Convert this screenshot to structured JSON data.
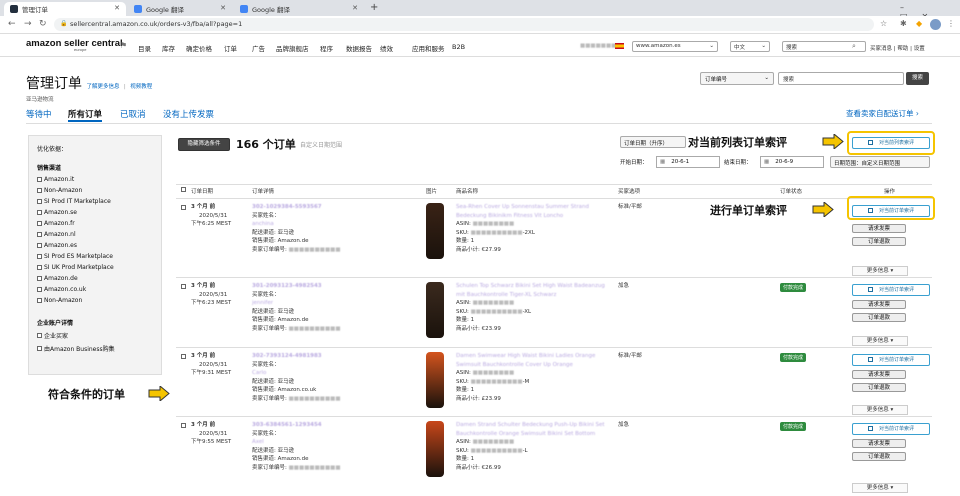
{
  "browser": {
    "tabs": [
      {
        "label": "管理订单",
        "favicon_color": "#232f3e"
      },
      {
        "label": "Google 翻译",
        "favicon_color": "#4285f4"
      },
      {
        "label": "Google 翻译",
        "favicon_color": "#4285f4"
      }
    ],
    "new_tab": "+",
    "url": "sellercentral.amazon.co.uk/orders-v3/fba/all?page=1"
  },
  "header": {
    "logo": "amazon seller central",
    "logo_sub": "europe",
    "nav": [
      "目录",
      "库存",
      "确定价格",
      "订单",
      "广告",
      "品牌旗舰店",
      "程序",
      "数据报告",
      "绩效",
      "应用和服务",
      "B2B"
    ],
    "marketplace": "www.amazon.es",
    "language": "中文",
    "search_placeholder": "搜索",
    "links": [
      "买家消息",
      "帮助",
      "设置"
    ]
  },
  "page": {
    "title": "管理订单",
    "link_learn": "了解更多信息",
    "link_video": "视频教程",
    "store_name": "亚马逊物流",
    "search_type": "订单编号",
    "search_placeholder": "搜索",
    "search_button": "搜索",
    "tabs": [
      "等待中",
      "所有订单",
      "已取消",
      "没有上传发票"
    ],
    "view_custom_orders": "查看卖家自配送订单 ›"
  },
  "filters": {
    "title": "优化依据：",
    "sales_channel_title": "销售渠道",
    "sales_channels": [
      "Amazon.it",
      "Non-Amazon",
      "SI Prod IT Marketplace",
      "Amazon.se",
      "Amazon.fr",
      "Amazon.nl",
      "Amazon.es",
      "SI Prod ES Marketplace",
      "SI UK Prod Marketplace",
      "Amazon.de",
      "Amazon.co.uk",
      "Non-Amazon"
    ],
    "business_title": "企业账户详情",
    "business_items": [
      "企业买家",
      "由Amazon Business购集"
    ]
  },
  "toolbar": {
    "refine_button": "隐藏筛选条件",
    "order_count": "166 个订单",
    "date_range_hint": "自定义日期范围",
    "sort_select": "订单日期（升序）",
    "start_label": "开始日期：",
    "start_value": "20-6-1",
    "end_label": "结束日期：",
    "end_value": "20-6-9",
    "range_select": "日期范围：自定义日期范围"
  },
  "table": {
    "headers": [
      "订单日期",
      "订单详情",
      "图片",
      "商品名称",
      "买家选项",
      "订单状态",
      "操作"
    ],
    "rows": [
      {
        "age": "3 个月 前",
        "date": "2020/5/31",
        "time": "下午6:25 MEST",
        "order_id": "302-1029384-5593567",
        "buyer_label": "买家姓名：",
        "buyer": "anchina",
        "shipping": "配送渠道: 亚马逊",
        "channel": "销售渠道: Amazon.de",
        "seller_id_label": "卖家订单编号:",
        "product_title": "Sea-Rhen Cover Up Sonnenstau Summer Strand Bedeckung Bikinikm Fitness Vit Loncho",
        "asin_label": "ASIN:",
        "sku_label": "SKU:",
        "sku_suffix": "-2XL",
        "qty": "数量: 1",
        "subtotal": "商品小计: €27.99",
        "option": "标准/平邮",
        "status": "",
        "color": "#3a2316",
        "actions": [
          "对当前订单索评",
          "请求发票",
          "订单退款"
        ]
      },
      {
        "age": "3 个月 前",
        "date": "2020/5/31",
        "time": "下午6:23 MEST",
        "order_id": "301-2093123-4982543",
        "buyer_label": "买家姓名：",
        "buyer": "jennifer",
        "shipping": "配送渠道: 亚马逊",
        "channel": "销售渠道: Amazon.de",
        "seller_id_label": "卖家订单编号:",
        "product_title": "Schulen Top Schwarz Bikini Set High Waist Badeanzug mit Bauchkontrolle Tiger-XL Schwarz",
        "asin_label": "ASIN:",
        "sku_label": "SKU:",
        "sku_suffix": "-XL",
        "qty": "数量: 1",
        "subtotal": "商品小计: €23.99",
        "option": "加急",
        "status": "付款完成",
        "color": "#3b2a1e",
        "actions": [
          "对当前订单索评",
          "请求发票",
          "订单退款"
        ]
      },
      {
        "age": "3 个月 前",
        "date": "2020/5/31",
        "time": "下午9:31 MEST",
        "order_id": "302-7393124-4981983",
        "buyer_label": "买家姓名：",
        "buyer": "Carlo",
        "shipping": "配送渠道: 亚马逊",
        "channel": "销售渠道: Amazon.co.uk",
        "seller_id_label": "卖家订单编号:",
        "product_title": "Damen Swimwear High Waist Bikini Ladies Orange Swimsuit Bauchkontrolle Cover Up Orange",
        "asin_label": "ASIN:",
        "sku_label": "SKU:",
        "sku_suffix": "-M",
        "qty": "数量: 1",
        "subtotal": "商品小计: £23.99",
        "option": "标准/平邮",
        "status": "付款完成",
        "color": "#d4541e",
        "actions": [
          "对当前订单索评",
          "请求发票",
          "订单退款"
        ]
      },
      {
        "age": "3 个月 前",
        "date": "2020/5/31",
        "time": "下午9:55 MEST",
        "order_id": "303-6384561-1293454",
        "buyer_label": "买家姓名：",
        "buyer": "Axel",
        "shipping": "配送渠道: 亚马逊",
        "channel": "销售渠道: Amazon.de",
        "seller_id_label": "卖家订单编号:",
        "product_title": "Damen Strand Schulter Bedeckung Push-Up Bikini Set Bauchkontrolle Orange Swimsuit Bikini Set Bottom",
        "asin_label": "ASIN:",
        "sku_label": "SKU:",
        "sku_suffix": "-L",
        "qty": "数量: 1",
        "subtotal": "商品小计: €26.99",
        "option": "加急",
        "status": "付款完成",
        "color": "#c8471a",
        "actions": [
          "对当前订单索评",
          "请求发票",
          "订单退款"
        ]
      }
    ],
    "more_info": "更多信息 ▾"
  },
  "annotations": {
    "top_callout": "对当前列表订单索评",
    "top_button": "对当前列表索评",
    "mid_callout": "进行单订单索评",
    "left_callout": "符合条件的订单"
  },
  "colors": {
    "accent_blue": "#0066c0",
    "highlight": "#f5c400",
    "status_green": "#2e8b3e"
  }
}
